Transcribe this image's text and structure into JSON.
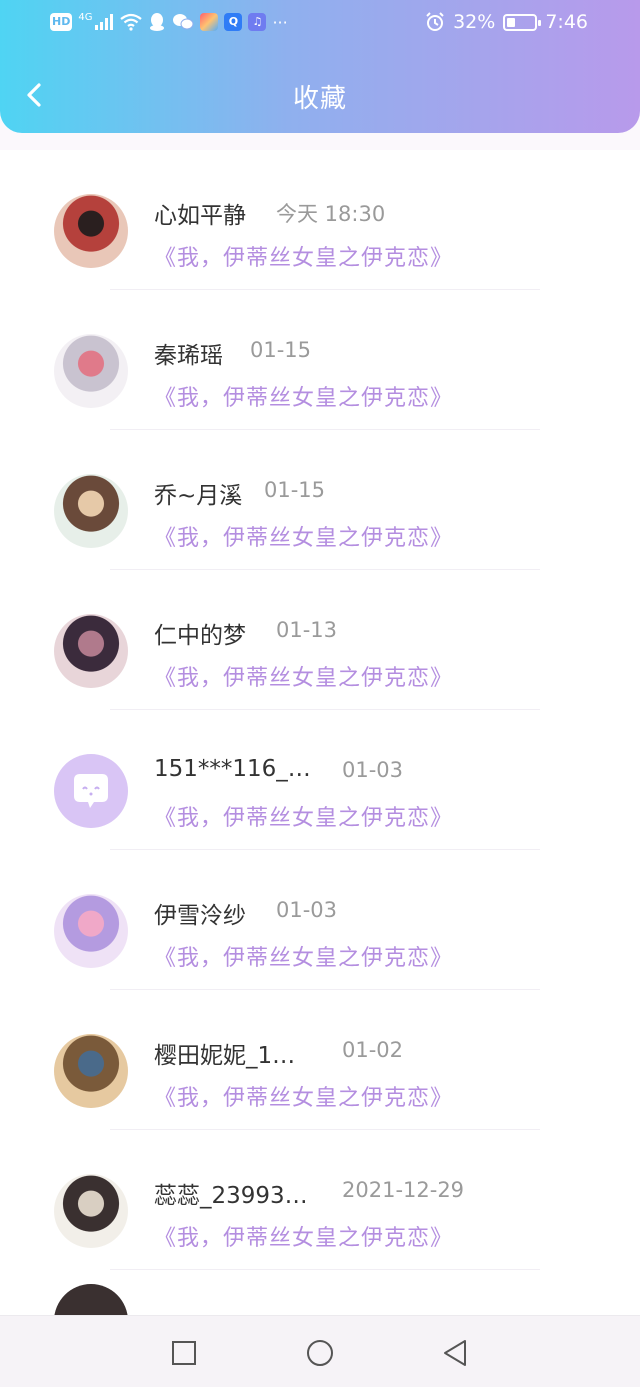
{
  "status_bar": {
    "network": "4G",
    "battery": "32%",
    "battery_level": 0.32,
    "time": "7:46"
  },
  "header": {
    "title": "收藏"
  },
  "list": {
    "items": [
      {
        "name": "心如平静",
        "time": "今天 18:30",
        "book": "《我，伊蒂丝女皇之伊克恋》",
        "avatar": "photo-avatar"
      },
      {
        "name": "秦琋瑶",
        "time": "01-15",
        "book": "《我，伊蒂丝女皇之伊克恋》",
        "avatar": "anime-avatar"
      },
      {
        "name": "乔~月溪",
        "time": "01-15",
        "book": "《我，伊蒂丝女皇之伊克恋》",
        "avatar": "anime-avatar"
      },
      {
        "name": "仁中的梦",
        "time": "01-13",
        "book": "《我，伊蒂丝女皇之伊克恋》",
        "avatar": "anime-avatar"
      },
      {
        "name": "151***116_…",
        "time": "01-03",
        "book": "《我，伊蒂丝女皇之伊克恋》",
        "avatar": "default-chat-avatar"
      },
      {
        "name": "伊雪泠纱",
        "time": "01-03",
        "book": "《我，伊蒂丝女皇之伊克恋》",
        "avatar": "anime-avatar"
      },
      {
        "name": "樱田妮妮_1…",
        "time": "01-02",
        "book": "《我，伊蒂丝女皇之伊克恋》",
        "avatar": "anime-avatar"
      },
      {
        "name": "蕊蕊_23993…",
        "time": "2021-12-29",
        "book": "《我，伊蒂丝女皇之伊克恋》",
        "avatar": "anime-avatar"
      }
    ]
  },
  "nav": {
    "icons": [
      "recent-apps-icon",
      "home-icon",
      "back-icon"
    ]
  }
}
